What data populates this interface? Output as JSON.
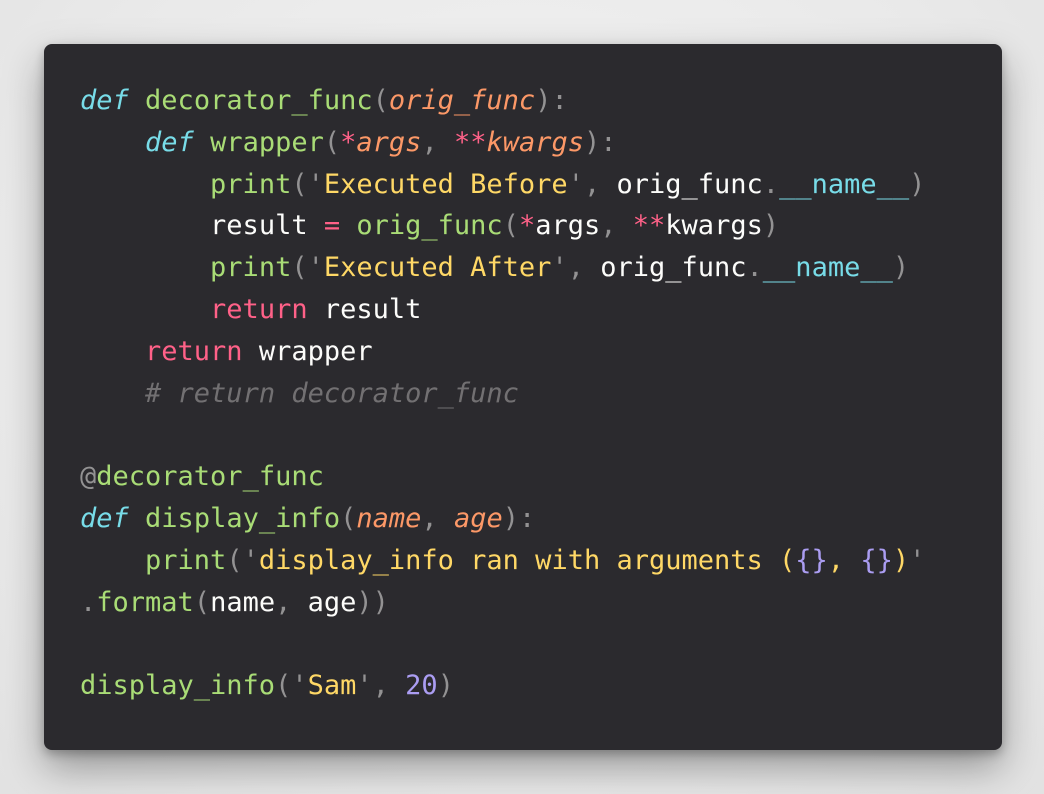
{
  "lines": [
    [
      {
        "t": "def",
        "c": "keyword-def"
      },
      {
        "t": " ",
        "c": "ident"
      },
      {
        "t": "decorator_func",
        "c": "func"
      },
      {
        "t": "(",
        "c": "punct"
      },
      {
        "t": "orig_func",
        "c": "param"
      },
      {
        "t": "):",
        "c": "punct"
      }
    ],
    [
      {
        "t": "    ",
        "c": "ident"
      },
      {
        "t": "def",
        "c": "keyword-def"
      },
      {
        "t": " ",
        "c": "ident"
      },
      {
        "t": "wrapper",
        "c": "func"
      },
      {
        "t": "(",
        "c": "punct"
      },
      {
        "t": "*",
        "c": "op"
      },
      {
        "t": "args",
        "c": "param"
      },
      {
        "t": ", ",
        "c": "punct"
      },
      {
        "t": "**",
        "c": "op"
      },
      {
        "t": "kwargs",
        "c": "param"
      },
      {
        "t": "):",
        "c": "punct"
      }
    ],
    [
      {
        "t": "        ",
        "c": "ident"
      },
      {
        "t": "print",
        "c": "func"
      },
      {
        "t": "(",
        "c": "punct"
      },
      {
        "t": "'",
        "c": "punct"
      },
      {
        "t": "Executed Before",
        "c": "string"
      },
      {
        "t": "'",
        "c": "punct"
      },
      {
        "t": ", ",
        "c": "punct"
      },
      {
        "t": "orig_func",
        "c": "ident"
      },
      {
        "t": ".",
        "c": "dot"
      },
      {
        "t": "__name__",
        "c": "dunder"
      },
      {
        "t": ")",
        "c": "punct"
      }
    ],
    [
      {
        "t": "        ",
        "c": "ident"
      },
      {
        "t": "result",
        "c": "ident"
      },
      {
        "t": " ",
        "c": "ident"
      },
      {
        "t": "=",
        "c": "op"
      },
      {
        "t": " ",
        "c": "ident"
      },
      {
        "t": "orig_func",
        "c": "func"
      },
      {
        "t": "(",
        "c": "punct"
      },
      {
        "t": "*",
        "c": "op"
      },
      {
        "t": "args",
        "c": "ident"
      },
      {
        "t": ", ",
        "c": "punct"
      },
      {
        "t": "**",
        "c": "op"
      },
      {
        "t": "kwargs",
        "c": "ident"
      },
      {
        "t": ")",
        "c": "punct"
      }
    ],
    [
      {
        "t": "        ",
        "c": "ident"
      },
      {
        "t": "print",
        "c": "func"
      },
      {
        "t": "(",
        "c": "punct"
      },
      {
        "t": "'",
        "c": "punct"
      },
      {
        "t": "Executed After",
        "c": "string"
      },
      {
        "t": "'",
        "c": "punct"
      },
      {
        "t": ", ",
        "c": "punct"
      },
      {
        "t": "orig_func",
        "c": "ident"
      },
      {
        "t": ".",
        "c": "dot"
      },
      {
        "t": "__name__",
        "c": "dunder"
      },
      {
        "t": ")",
        "c": "punct"
      }
    ],
    [
      {
        "t": "        ",
        "c": "ident"
      },
      {
        "t": "return",
        "c": "keyword"
      },
      {
        "t": " ",
        "c": "ident"
      },
      {
        "t": "result",
        "c": "ident"
      }
    ],
    [
      {
        "t": "    ",
        "c": "ident"
      },
      {
        "t": "return",
        "c": "keyword"
      },
      {
        "t": " ",
        "c": "ident"
      },
      {
        "t": "wrapper",
        "c": "ident"
      }
    ],
    [
      {
        "t": "    ",
        "c": "ident"
      },
      {
        "t": "# return decorator_func",
        "c": "comment"
      }
    ],
    [],
    [
      {
        "t": "@",
        "c": "punct"
      },
      {
        "t": "decorator_func",
        "c": "decorator"
      }
    ],
    [
      {
        "t": "def",
        "c": "keyword-def"
      },
      {
        "t": " ",
        "c": "ident"
      },
      {
        "t": "display_info",
        "c": "func"
      },
      {
        "t": "(",
        "c": "punct"
      },
      {
        "t": "name",
        "c": "param"
      },
      {
        "t": ", ",
        "c": "punct"
      },
      {
        "t": "age",
        "c": "param"
      },
      {
        "t": "):",
        "c": "punct"
      }
    ],
    [
      {
        "t": "    ",
        "c": "ident"
      },
      {
        "t": "print",
        "c": "func"
      },
      {
        "t": "(",
        "c": "punct"
      },
      {
        "t": "'",
        "c": "punct"
      },
      {
        "t": "display_info ran with arguments (",
        "c": "string"
      },
      {
        "t": "{}",
        "c": "brace"
      },
      {
        "t": ", ",
        "c": "string"
      },
      {
        "t": "{}",
        "c": "brace"
      },
      {
        "t": ")",
        "c": "string"
      },
      {
        "t": "'",
        "c": "punct"
      }
    ],
    [
      {
        "t": ".",
        "c": "dot"
      },
      {
        "t": "format",
        "c": "func"
      },
      {
        "t": "(",
        "c": "punct"
      },
      {
        "t": "name",
        "c": "ident"
      },
      {
        "t": ", ",
        "c": "punct"
      },
      {
        "t": "age",
        "c": "ident"
      },
      {
        "t": "))",
        "c": "punct"
      }
    ],
    [],
    [
      {
        "t": "display_info",
        "c": "func"
      },
      {
        "t": "(",
        "c": "punct"
      },
      {
        "t": "'",
        "c": "punct"
      },
      {
        "t": "Sam",
        "c": "string"
      },
      {
        "t": "'",
        "c": "punct"
      },
      {
        "t": ", ",
        "c": "punct"
      },
      {
        "t": "20",
        "c": "number"
      },
      {
        "t": ")",
        "c": "punct"
      }
    ]
  ]
}
